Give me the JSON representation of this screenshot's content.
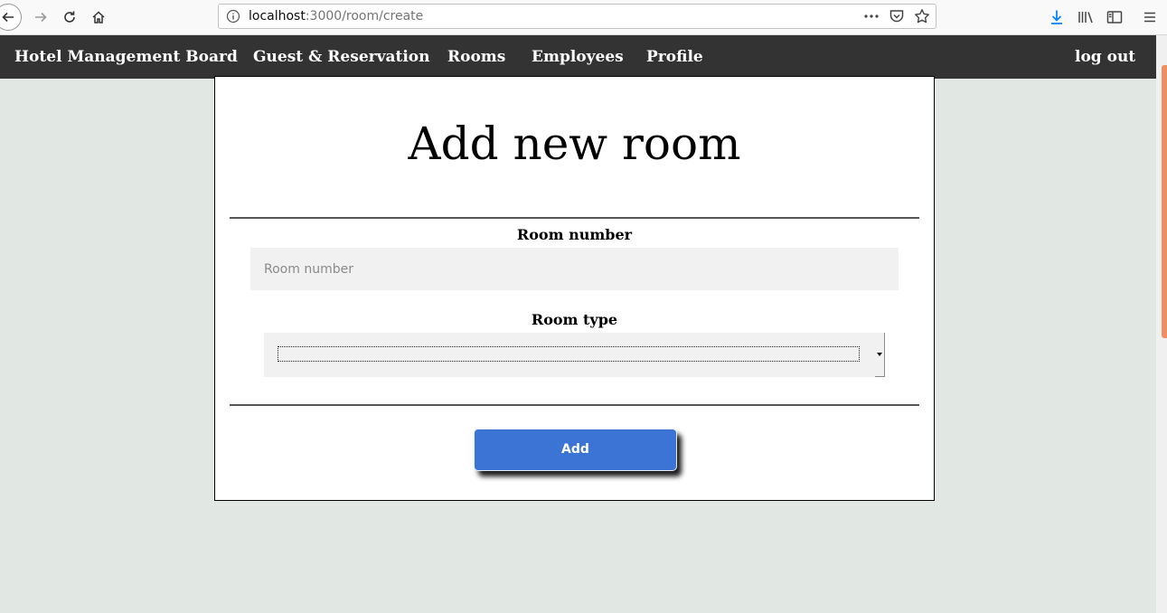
{
  "browser": {
    "url_host": "localhost",
    "url_rest": ":3000/room/create",
    "colors": {
      "accent_download": "#0a84ff",
      "scroll_thumb": "#ee8f63"
    },
    "icons": [
      "back-icon",
      "forward-icon",
      "reload-icon",
      "home-icon",
      "info-icon",
      "more-icon",
      "pocket-icon",
      "bookmark-star-icon",
      "download-icon",
      "library-icon",
      "sidebar-icon",
      "menu-icon"
    ]
  },
  "navbar": {
    "brand": "Hotel Management Board",
    "items": [
      {
        "label": "Guest & Reservation"
      },
      {
        "label": "Rooms"
      },
      {
        "label": "Employees"
      },
      {
        "label": "Profile"
      }
    ],
    "logout": "log out",
    "background": "#333333"
  },
  "form": {
    "title": "Add new room",
    "room_number_label": "Room number",
    "room_number_placeholder": "Room number",
    "room_number_value": "",
    "room_type_label": "Room type",
    "room_type_selected": "",
    "submit_label": "Add",
    "submit_color": "#3b74d4"
  }
}
